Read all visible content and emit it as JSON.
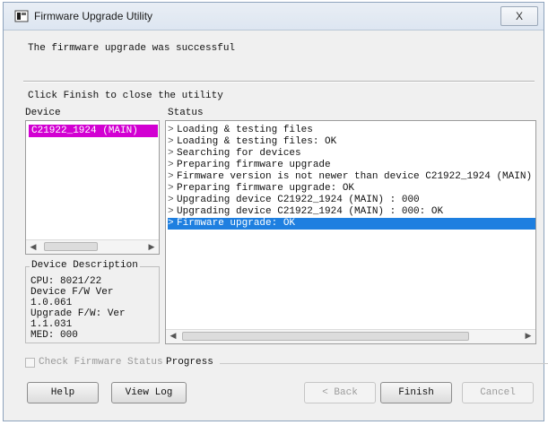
{
  "window": {
    "title": "Firmware Upgrade Utility",
    "close_glyph": "X"
  },
  "message": "The firmware upgrade was successful",
  "hint": "Click Finish to close the utility",
  "device_panel": {
    "label": "Device",
    "items": [
      "C21922_1924 (MAIN)"
    ],
    "description_title": "Device Description",
    "description_lines": [
      "CPU:  8021/22",
      "Device F/W  Ver",
      "1.0.061",
      "Upgrade F/W: Ver",
      "1.1.031",
      "MED: 000"
    ]
  },
  "status_panel": {
    "label": "Status",
    "rows": [
      "Loading & testing files",
      "Loading & testing files: OK",
      "Searching for devices",
      "Preparing firmware upgrade",
      "Firmware version is not newer than device C21922_1924 (MAIN)",
      "Preparing firmware upgrade: OK",
      "Upgrading device C21922_1924 (MAIN) : 000",
      "Upgrading device C21922_1924 (MAIN) : 000: OK",
      "Firmware upgrade: OK"
    ],
    "selected_index": 8
  },
  "progress": {
    "checkbox_label": "Check Firmware Status",
    "label": "Progress"
  },
  "buttons": {
    "help": "Help",
    "view_log": "View Log",
    "back": "< Back",
    "finish": "Finish",
    "cancel": "Cancel"
  },
  "colors": {
    "device_highlight": "#d200d2",
    "selection": "#1e7fe0"
  }
}
